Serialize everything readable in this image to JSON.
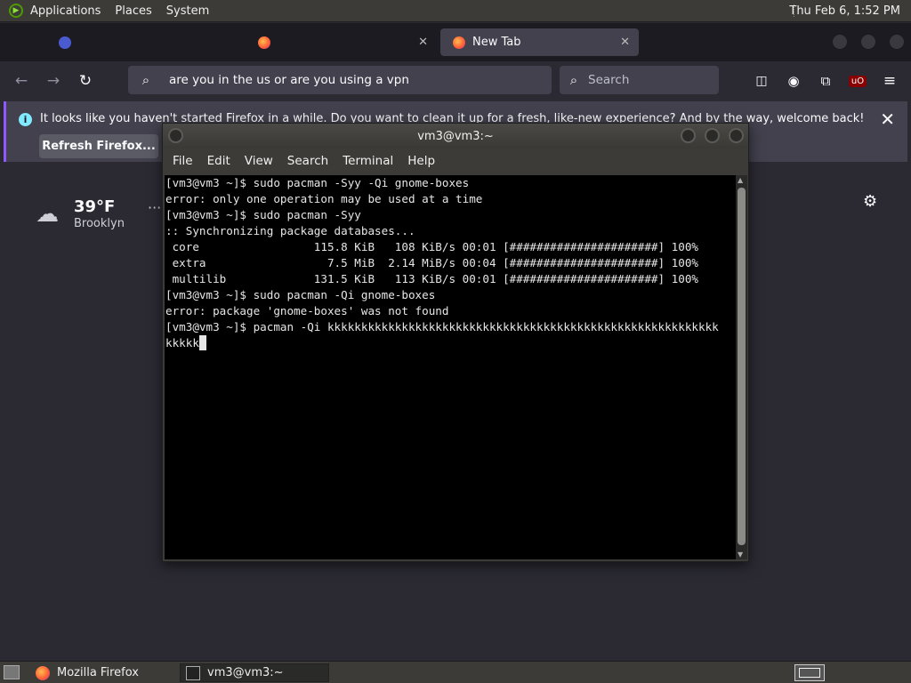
{
  "top_panel": {
    "menus": [
      "Applications",
      "Places",
      "System"
    ],
    "clock": "Thu Feb  6,  1:52 PM"
  },
  "firefox": {
    "tabs": [
      {
        "label": "",
        "active": false
      },
      {
        "label": "",
        "active": false
      },
      {
        "label": "New Tab",
        "active": true
      }
    ],
    "urlbar_value": "are you in the us or are you using a vpn",
    "search_placeholder": "Search",
    "notification": {
      "message": "It looks like you haven't started Firefox in a while. Do you want to clean it up for a fresh, like-new experience? And by the way, welcome back!",
      "button": "Refresh Firefox..."
    },
    "weather": {
      "temp": "39°F",
      "city": "Brooklyn",
      "more": "···"
    }
  },
  "terminal": {
    "title": "vm3@vm3:~",
    "menus": [
      "File",
      "Edit",
      "View",
      "Search",
      "Terminal",
      "Help"
    ],
    "lines": [
      "[vm3@vm3 ~]$ sudo pacman -Syy -Qi gnome-boxes",
      "error: only one operation may be used at a time",
      "[vm3@vm3 ~]$ sudo pacman -Syy",
      ":: Synchronizing package databases...",
      " core                 115.8 KiB   108 KiB/s 00:01 [######################] 100%",
      " extra                  7.5 MiB  2.14 MiB/s 00:04 [######################] 100%",
      " multilib             131.5 KiB   113 KiB/s 00:01 [######################] 100%",
      "[vm3@vm3 ~]$ sudo pacman -Qi gnome-boxes",
      "error: package 'gnome-boxes' was not found",
      "[vm3@vm3 ~]$ pacman -Qi kkkkkkkkkkkkkkkkkkkkkkkkkkkkkkkkkkkkkkkkkkkkkkkkkkkkkkkkkk"
    ],
    "current_input": "kkkkk"
  },
  "taskbar": {
    "items": [
      "Mozilla Firefox",
      "vm3@vm3:~"
    ]
  }
}
